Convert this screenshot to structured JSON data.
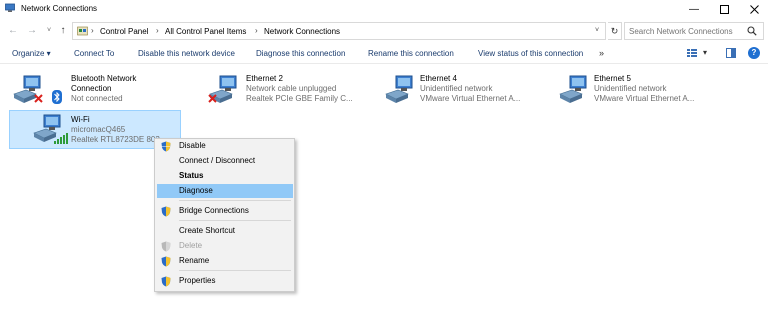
{
  "window": {
    "title": "Network Connections"
  },
  "address": {
    "crumbs": [
      "Control Panel",
      "All Control Panel Items",
      "Network Connections"
    ]
  },
  "search": {
    "placeholder": "Search Network Connections"
  },
  "toolbar": {
    "organize": "Organize ▾",
    "connect_to": "Connect To",
    "disable_device": "Disable this network device",
    "diagnose_connection": "Diagnose this connection",
    "rename_connection": "Rename this connection",
    "view_status": "View status of this connection",
    "more": "»"
  },
  "connections": [
    {
      "name1": "Bluetooth Network",
      "name2": "Connection",
      "status": "Not connected",
      "device": "",
      "icon": "bluetooth-adapter-icon",
      "badge": "x"
    },
    {
      "name1": "Ethernet 2",
      "name2": "",
      "status": "Network cable unplugged",
      "device": "Realtek PCIe GBE Family C...",
      "icon": "ethernet-adapter-icon",
      "badge": "x"
    },
    {
      "name1": "Ethernet 4",
      "name2": "",
      "status": "Unidentified network",
      "device": "VMware Virtual Ethernet A...",
      "icon": "ethernet-adapter-icon",
      "badge": ""
    },
    {
      "name1": "Ethernet 5",
      "name2": "",
      "status": "Unidentified network",
      "device": "VMware Virtual Ethernet A...",
      "icon": "ethernet-adapter-icon",
      "badge": ""
    },
    {
      "name1": "Wi-Fi",
      "name2": "",
      "status": "micromacQ465",
      "device": "Realtek RTL8723DE 802...",
      "icon": "wifi-adapter-icon",
      "badge": "signal"
    }
  ],
  "context_menu": {
    "items": [
      {
        "label": "Disable",
        "shield": true
      },
      {
        "label": "Connect / Disconnect",
        "shield": false
      },
      {
        "label": "Status",
        "shield": false,
        "bold": true
      },
      {
        "label": "Diagnose",
        "shield": false,
        "highlighted": true
      },
      {
        "label": "Bridge Connections",
        "shield": true
      },
      {
        "label": "Create Shortcut",
        "shield": false
      },
      {
        "label": "Delete",
        "shield": true,
        "disabled": true
      },
      {
        "label": "Rename",
        "shield": true
      },
      {
        "label": "Properties",
        "shield": true
      }
    ]
  },
  "colors": {
    "selection_bg": "#cce8ff",
    "menu_highlight": "#91c9f7",
    "command_text": "#1a3b6d",
    "error_red": "#d9201c"
  }
}
